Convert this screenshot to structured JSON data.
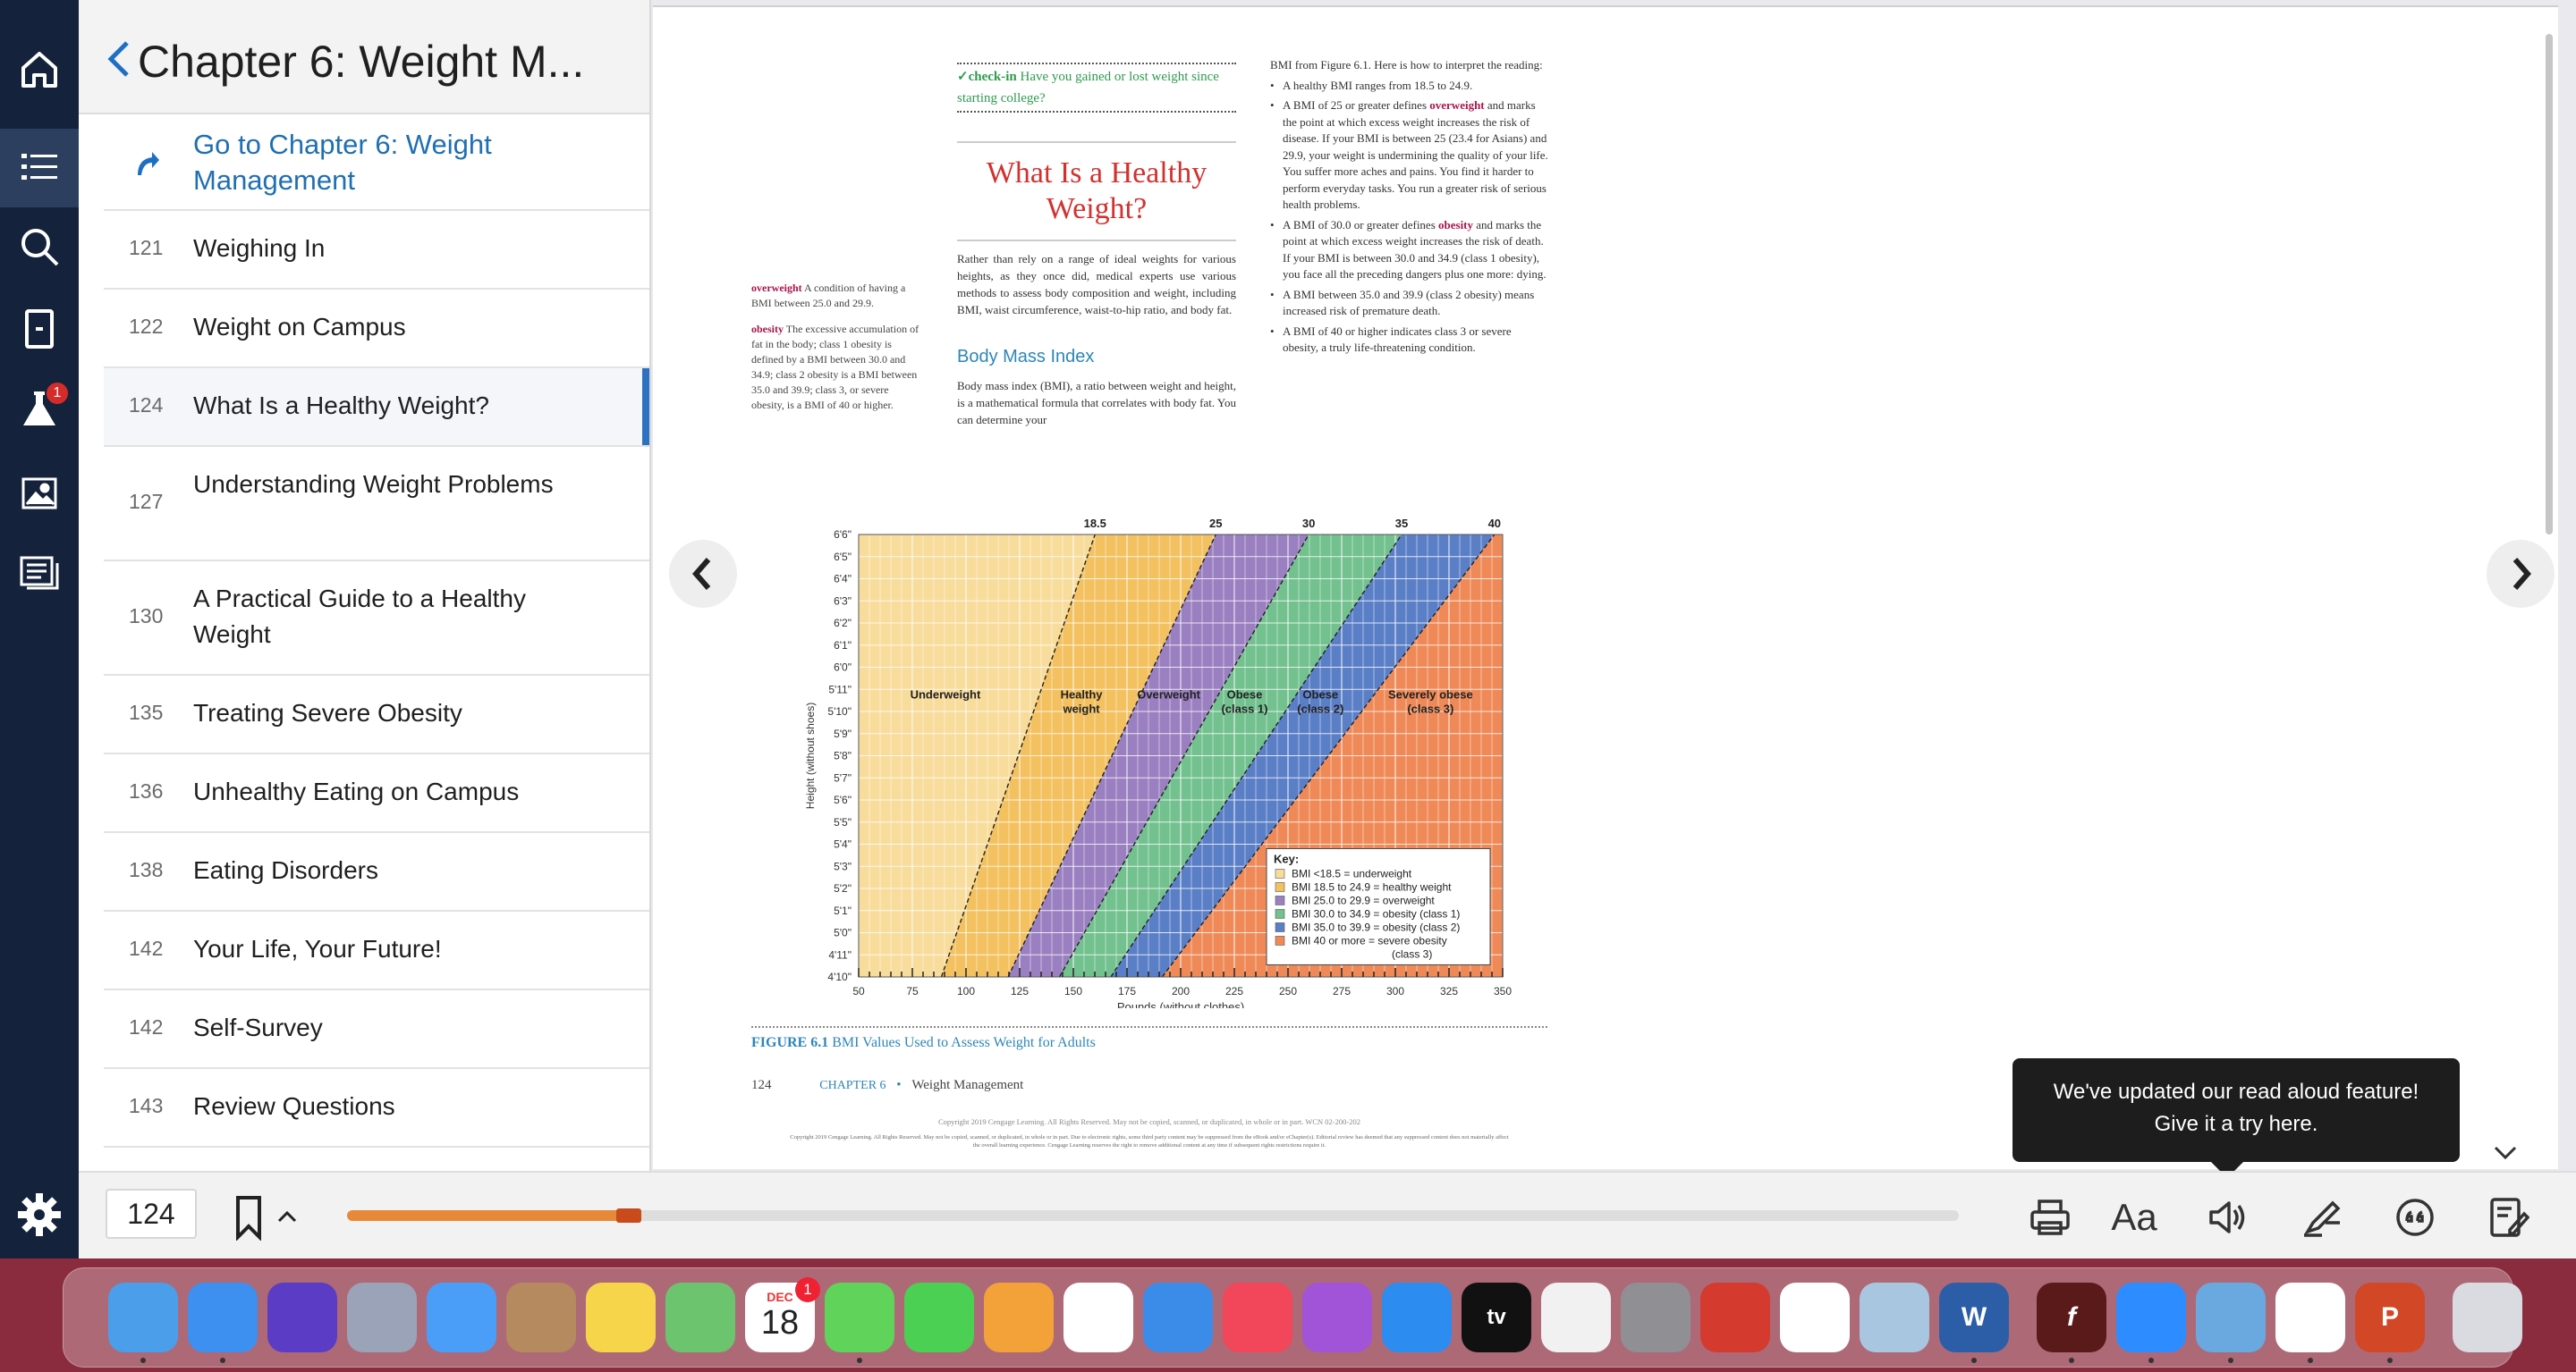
{
  "toc": {
    "title": "Chapter 6: Weight M...",
    "goto_label": "Go to Chapter 6: Weight Management",
    "items": [
      {
        "num": "121",
        "label": "Weighing In"
      },
      {
        "num": "122",
        "label": "Weight on Campus"
      },
      {
        "num": "124",
        "label": "What Is a Healthy Weight?"
      },
      {
        "num": "127",
        "label": "Understanding Weight Problems"
      },
      {
        "num": "130",
        "label": "A Practical Guide to a Healthy Weight"
      },
      {
        "num": "135",
        "label": "Treating Severe Obesity"
      },
      {
        "num": "136",
        "label": "Unhealthy Eating on Campus"
      },
      {
        "num": "138",
        "label": "Eating Disorders"
      },
      {
        "num": "142",
        "label": "Your Life, Your Future!"
      },
      {
        "num": "142",
        "label": "Self-Survey"
      },
      {
        "num": "143",
        "label": "Review Questions"
      }
    ],
    "active_index": 2
  },
  "rail": {
    "icons": [
      "home-icon",
      "toc-list-icon",
      "search-icon",
      "book-icon",
      "flask-icon",
      "image-icon",
      "notes-icon"
    ],
    "flask_badge": "1"
  },
  "book": {
    "checkin_label": "✓check-in",
    "checkin_text": "Have you gained or lost weight since starting college?",
    "section_title": "What Is a Healthy Weight?",
    "intro_para": "Rather than rely on a range of ideal weights for various heights, as they once did, medical experts use various methods to assess body composition and weight, including BMI, waist circumference, waist-to-hip ratio, and body fat.",
    "bmi_heading": "Body Mass Index",
    "bmi_para": "Body mass index (BMI), a ratio between weight and height, is a mathematical formula that correlates with body fat. You can determine your",
    "gloss_overweight_term": "overweight",
    "gloss_overweight_def": "A condition of having a BMI between 25.0 and 29.9.",
    "gloss_obesity_term": "obesity",
    "gloss_obesity_def": "The excessive accumulation of fat in the body; class 1 obesity is defined by a BMI between 30.0 and 34.9; class 2 obesity is a BMI between 35.0 and 39.9; class 3, or severe obesity, is a BMI of 40 or higher.",
    "right_intro": "BMI from Figure 6.1. Here is how to interpret the reading:",
    "right_b1": "A healthy BMI ranges from 18.5 to 24.9.",
    "right_b2a": "A BMI of 25 or greater defines",
    "right_b2_term": "overweight",
    "right_b2b": "and marks the point at which excess weight increases the risk of disease. If your BMI is between 25 (23.4 for Asians) and 29.9, your weight is undermining the quality of your life. You suffer more aches and pains. You find it harder to perform everyday tasks. You run a greater risk of serious health problems.",
    "right_b3a": "A BMI of 30.0 or greater defines",
    "right_b3_term": "obesity",
    "right_b3b": "and marks the point at which excess weight increases the risk of death. If your BMI is between 30.0 and 34.9 (class 1 obesity), you face all the preceding dangers plus one more: dying.",
    "right_b4": "A BMI between 35.0 and 39.9 (class 2 obesity) means increased risk of premature death.",
    "right_b5": "A BMI of 40 or higher indicates class 3 or severe obesity, a truly life-threatening condition.",
    "fig_label": "FIGURE 6.1",
    "fig_title": "BMI Values Used to Assess Weight for Adults",
    "folio_page": "124",
    "folio_chapter": "CHAPTER 6",
    "folio_sep": "•",
    "folio_title": "Weight Management",
    "copyright1": "Copyright 2019 Cengage Learning. All Rights Reserved. May not be copied, scanned, or duplicated, in whole or in part. WCN 02-200-202",
    "copyright2": "Copyright 2019 Cengage Learning. All Rights Reserved. May not be copied, scanned, or duplicated, in whole or in part. Due to electronic rights, some third party content may be suppressed from the eBook and/or eChapter(s). Editorial review has deemed that any suppressed content does not materially affect the overall learning experience. Cengage Learning reserves the right to remove additional content at any time if subsequent rights restrictions require it."
  },
  "chart_data": {
    "type": "area",
    "xlabel": "Pounds (without clothes)",
    "ylabel": "Height (without shoes)",
    "x_ticks": [
      "50",
      "75",
      "100",
      "125",
      "150",
      "175",
      "200",
      "225",
      "250",
      "275",
      "300",
      "325",
      "350"
    ],
    "x_range": [
      50,
      350
    ],
    "y_ticks": [
      "4'10\"",
      "4'11\"",
      "5'0\"",
      "5'1\"",
      "5'2\"",
      "5'3\"",
      "5'4\"",
      "5'5\"",
      "5'6\"",
      "5'7\"",
      "5'8\"",
      "5'9\"",
      "5'10\"",
      "5'11\"",
      "6'0\"",
      "6'1\"",
      "6'2\"",
      "6'3\"",
      "6'4\"",
      "6'5\"",
      "6'6\""
    ],
    "y_range_inches": [
      58,
      78
    ],
    "bmi_boundaries": [
      "18.5",
      "25",
      "30",
      "35",
      "40"
    ],
    "bmi_boundary_values": [
      18.5,
      25,
      30,
      35,
      40
    ],
    "zones": [
      {
        "name": "Underweight",
        "color": "#f8dc9b"
      },
      {
        "name": "Healthy weight",
        "color": "#f3c160"
      },
      {
        "name": "Overweight",
        "color": "#9a80c0"
      },
      {
        "name": "Obese (class 1)",
        "color": "#72c18e"
      },
      {
        "name": "Obese (class 2)",
        "color": "#5b7fc7"
      },
      {
        "name": "Severely obese (class 3)",
        "color": "#ef8a58"
      }
    ],
    "zone_labels": [
      {
        "line1": "Underweight",
        "line2": ""
      },
      {
        "line1": "Healthy",
        "line2": "weight"
      },
      {
        "line1": "Overweight",
        "line2": ""
      },
      {
        "line1": "Obese",
        "line2": "(class 1)"
      },
      {
        "line1": "Obese",
        "line2": "(class 2)"
      },
      {
        "line1": "Severely obese",
        "line2": "(class 3)"
      }
    ],
    "key_title": "Key:",
    "key_items": [
      "BMI <18.5 = underweight",
      "BMI 18.5 to 24.9 = healthy weight",
      "BMI 25.0 to 29.9 = overweight",
      "BMI 30.0 to 34.9 = obesity (class 1)",
      "BMI 35.0 to 39.9 = obesity (class 2)",
      "BMI 40 or more = severe obesity"
    ],
    "key_item_last_line2": "(class 3)",
    "grid": true
  },
  "tooltip": {
    "line1": "We've updated our read aloud feature!",
    "line2": "Give it a try here."
  },
  "toolbar": {
    "page_number": "124",
    "progress": 0.175,
    "aa_label": "Aa",
    "icons": [
      "print-icon",
      "text-size-icon",
      "read-aloud-icon",
      "highlighter-icon",
      "citation-icon",
      "notebook-icon"
    ]
  },
  "dock": {
    "calendar_month": "DEC",
    "calendar_day": "18",
    "calendar_badge": "1",
    "apps": [
      "finder",
      "safari",
      "siri",
      "launchpad",
      "mail",
      "contacts",
      "notes",
      "maps",
      "calendar",
      "messages",
      "facetime",
      "pages",
      "photos",
      "keynote",
      "music",
      "podcasts",
      "app-store",
      "apple-tv",
      "textedit",
      "system-preferences",
      "photo-booth",
      "reminders",
      "preview",
      "word",
      "flash",
      "zoom",
      "network-utility",
      "chrome",
      "powerpoint",
      "trash"
    ],
    "word_letter": "W",
    "powerpoint_letter": "P",
    "flash_letter": "f",
    "tv_label": "tv"
  }
}
